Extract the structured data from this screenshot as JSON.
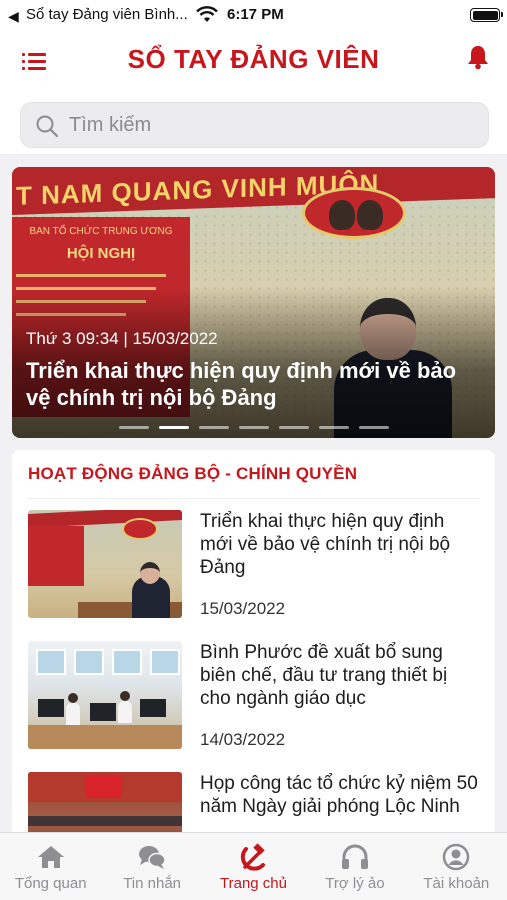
{
  "status_bar": {
    "back_arrow": "◀",
    "back_app": "Sổ tay Đảng viên Bình...",
    "time": "6:17 PM"
  },
  "header": {
    "title": "SỔ TAY ĐẢNG VIÊN",
    "menu_icon": "menu-icon",
    "notification_icon": "bell-icon"
  },
  "search": {
    "placeholder": "Tìm kiếm",
    "value": ""
  },
  "hero": {
    "date": "Thứ 3  09:34 | 15/03/2022",
    "title": "Triển khai thực hiện quy định mới về bảo vệ chính trị nội bộ Đảng",
    "slide_count": 7,
    "active_slide": 2,
    "image_banner_text": "T NAM QUANG VINH MUÔN",
    "image_board_heading": "HỘI NGHỊ",
    "image_board_sub": "BAN TỔ CHỨC TRUNG ƯƠNG"
  },
  "news_section": {
    "title": "HOẠT ĐỘNG ĐẢNG BỘ - CHÍNH QUYỀN",
    "items": [
      {
        "title": "Triển khai thực hiện quy định mới về bảo vệ chính trị nội bộ Đảng",
        "date": "15/03/2022"
      },
      {
        "title": "Bình Phước đề xuất bổ sung biên chế, đầu tư trang thiết bị cho ngành giáo dục",
        "date": "14/03/2022"
      },
      {
        "title": "Họp công tác tổ chức kỷ niệm 50 năm Ngày giải phóng Lộc Ninh",
        "date": ""
      }
    ]
  },
  "tabbar": {
    "tabs": [
      {
        "label": "Tổng quan",
        "icon": "home-icon"
      },
      {
        "label": "Tin nhắn",
        "icon": "chat-icon"
      },
      {
        "label": "Trang chủ",
        "icon": "hammer-sickle-icon"
      },
      {
        "label": "Trợ lý ảo",
        "icon": "headphones-icon"
      },
      {
        "label": "Tài khoản",
        "icon": "account-icon"
      }
    ],
    "active": "Trang chủ"
  },
  "colors": {
    "brand_red": "#c8161d",
    "inactive_gray": "#8e8e93",
    "background": "#f1f1f3"
  }
}
